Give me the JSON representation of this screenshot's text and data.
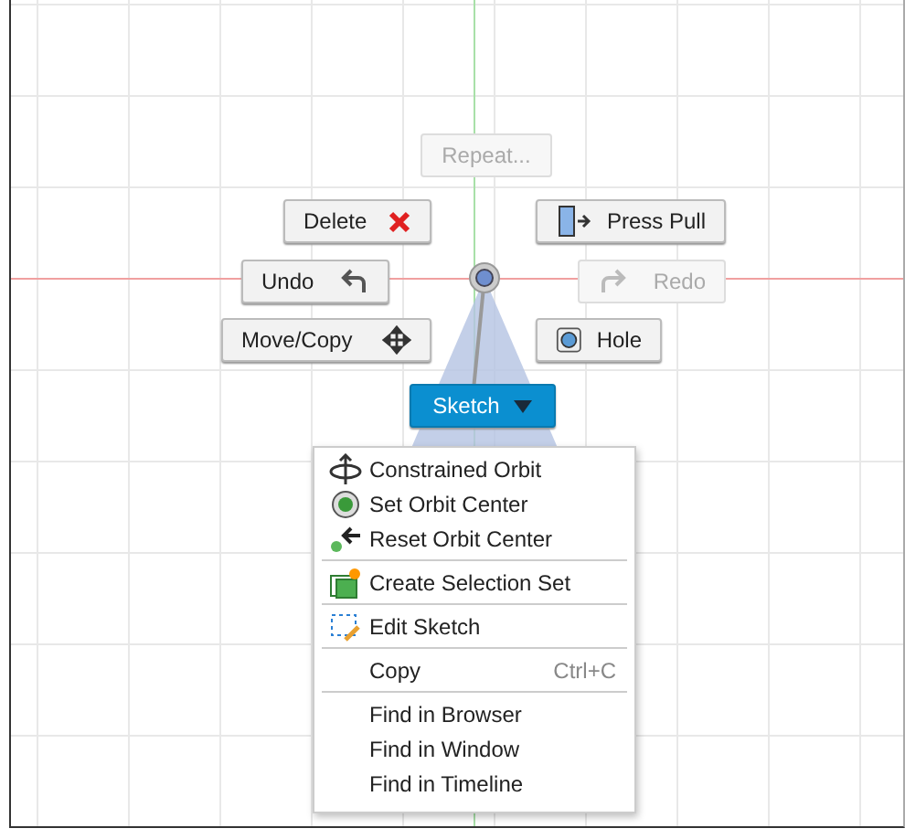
{
  "marking_menu": {
    "buttons": [
      {
        "label": "Repeat...",
        "kind": "repeat",
        "disabled": true
      },
      {
        "label": "Delete",
        "kind": "delete",
        "disabled": false
      },
      {
        "label": "Press Pull",
        "kind": "presspull",
        "disabled": false
      },
      {
        "label": "Undo",
        "kind": "undo",
        "disabled": false
      },
      {
        "label": "Redo",
        "kind": "redo",
        "disabled": true
      },
      {
        "label": "Move/Copy",
        "kind": "move",
        "disabled": false
      },
      {
        "label": "Hole",
        "kind": "hole",
        "disabled": false
      },
      {
        "label": "Sketch",
        "kind": "dropdown",
        "disabled": false
      }
    ]
  },
  "context_menu": {
    "groups": [
      [
        {
          "label": "Constrained Orbit",
          "kind": "orbit"
        },
        {
          "label": "Set Orbit Center",
          "kind": "target"
        },
        {
          "label": "Reset Orbit Center",
          "kind": "reset"
        }
      ],
      [
        {
          "label": "Create Selection Set",
          "kind": "selection"
        }
      ],
      [
        {
          "label": "Edit Sketch",
          "kind": "editsketch"
        }
      ],
      [
        {
          "label": "Copy",
          "shortcut": "Ctrl+C"
        }
      ],
      [
        {
          "label": "Find in Browser"
        },
        {
          "label": "Find in Window"
        },
        {
          "label": "Find in Timeline"
        }
      ]
    ]
  }
}
